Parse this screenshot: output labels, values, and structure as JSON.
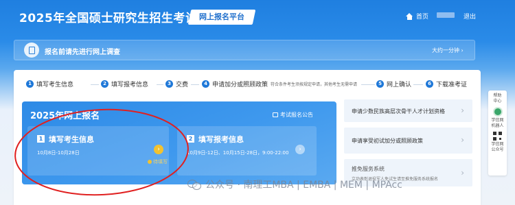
{
  "header": {
    "title": "2025年全国硕士研究生招生考试",
    "platform": "网上报名平台",
    "home_label": "首页",
    "logout_label": "退出"
  },
  "survey": {
    "text": "报名前请先进行网上调查",
    "time": "大约一分钟"
  },
  "steps": [
    {
      "num": "1",
      "label": "填写考生信息"
    },
    {
      "num": "2",
      "label": "填写报考信息"
    },
    {
      "num": "3",
      "label": "交费"
    },
    {
      "num": "4",
      "label": "申请加分或照顾政策",
      "note": "符合条件考生须按规定申请，其他考生无需申请"
    },
    {
      "num": "5",
      "label": "网上确认"
    },
    {
      "num": "6",
      "label": "下载准考证"
    }
  ],
  "main": {
    "title": "2025年网上报名",
    "notice": "考试报名公告",
    "card1": {
      "num": "1",
      "title": "填写考生信息",
      "dates": "10月8日-10月28日",
      "status": "待填写"
    },
    "card2": {
      "num": "2",
      "title": "填写报考信息",
      "dates": "10月9日-12日、10月15日-28日，9:00-22:00"
    }
  },
  "side": {
    "item1": "申请少数民族高层次骨干人才计划资格",
    "item2": "申请享受初试加分或照顾政策",
    "item3": "推免服务系统",
    "item3_sub": "立功表彰退役军人免试生请至推免服务系统报名"
  },
  "float": {
    "help": "帮助中心",
    "robot": "学信网机器人",
    "wechat": "学信网公众号"
  },
  "watermark": "公众号 · 南理工MBA | EMBA | MEM | MPAcc",
  "colors": {
    "primary": "#1f78d8",
    "annotation": "#e02020"
  }
}
